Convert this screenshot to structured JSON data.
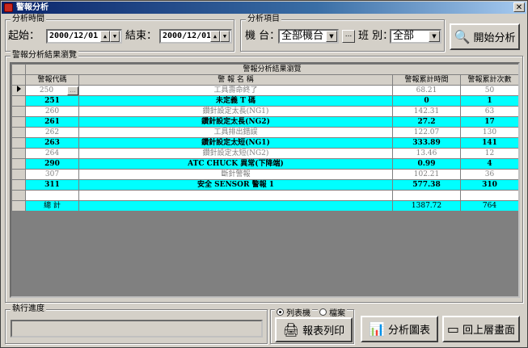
{
  "window": {
    "title": "警報分析",
    "close_glyph": "✕"
  },
  "period": {
    "group_label": "分析時間",
    "start_label": "起始：",
    "start_value": "2000/12/01",
    "end_label": "結束：",
    "end_value": "2000/12/01"
  },
  "items": {
    "group_label": "分析項目",
    "machine_label": "機 台：",
    "machine_value": "全部機台",
    "ellipsis": "...",
    "shift_label": "班 別：",
    "shift_value": "全部"
  },
  "start_button": {
    "label": "開始分析",
    "icon": "magnifier-icon"
  },
  "results": {
    "group_label": "警報分析結果瀏覽",
    "table_title": "警報分析結果瀏覽",
    "columns": [
      "警報代碼",
      "警 報 名 稱",
      "警報累計時間",
      "警報累計次數"
    ],
    "rows": [
      {
        "code": "250",
        "name": "工具壽命終了",
        "time": "68.21",
        "count": "50",
        "style": "plain"
      },
      {
        "code": "251",
        "name": "未定義 T 碼",
        "time": "0",
        "count": "1",
        "style": "cyan"
      },
      {
        "code": "260",
        "name": "鑽針設定太長(NG1)",
        "time": "142.31",
        "count": "63",
        "style": "plain"
      },
      {
        "code": "261",
        "name": "鑽針設定太長(NG2)",
        "time": "27.2",
        "count": "17",
        "style": "cyan"
      },
      {
        "code": "262",
        "name": "工具排出錯誤",
        "time": "122.07",
        "count": "130",
        "style": "plain"
      },
      {
        "code": "263",
        "name": "鑽針設定太短(NG1)",
        "time": "333.89",
        "count": "141",
        "style": "cyan"
      },
      {
        "code": "264",
        "name": "鑽針設定太短(NG2)",
        "time": "13.46",
        "count": "12",
        "style": "plain"
      },
      {
        "code": "290",
        "name": "ATC CHUCK 異常(下降端)",
        "time": "0.99",
        "count": "4",
        "style": "cyan"
      },
      {
        "code": "307",
        "name": "斷針警報",
        "time": "102.21",
        "count": "36",
        "style": "plain"
      },
      {
        "code": "311",
        "name": "安全 SENSOR 警報 1",
        "time": "577.38",
        "count": "310",
        "style": "cyan"
      },
      {
        "code": "",
        "name": "",
        "time": "",
        "count": "",
        "style": "blank"
      },
      {
        "code": "總 計",
        "name": "",
        "time": "1387.72",
        "count": "764",
        "style": "total"
      }
    ]
  },
  "progress": {
    "group_label": "執行進度"
  },
  "output": {
    "printer_label": "列表機",
    "file_label": "檔案",
    "selected": "printer"
  },
  "buttons": {
    "print": {
      "label": "報表列印",
      "icon": "printer-icon"
    },
    "chart": {
      "label": "分析圖表",
      "icon": "chart-icon"
    },
    "back": {
      "label": "回上層畫面",
      "icon": "back-icon"
    }
  }
}
